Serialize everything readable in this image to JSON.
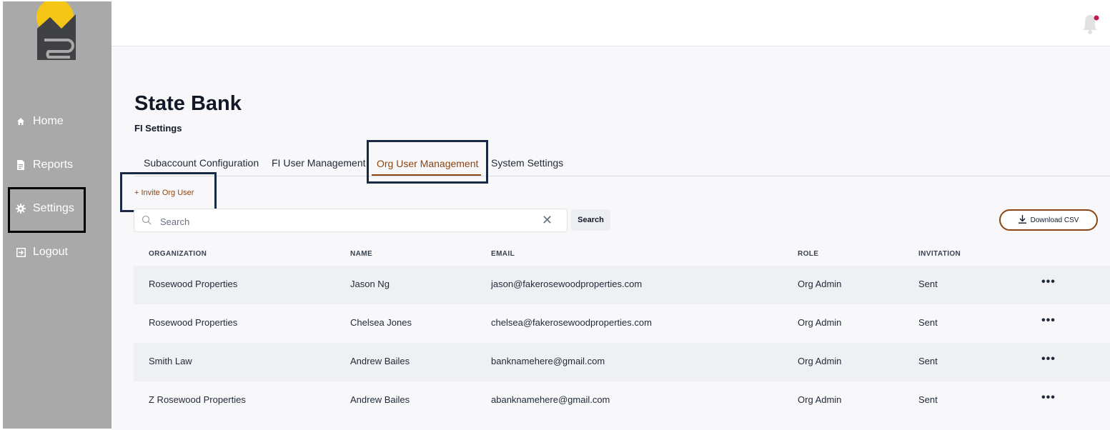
{
  "sidebar": {
    "items": [
      {
        "label": "Home",
        "icon": "home-icon"
      },
      {
        "label": "Reports",
        "icon": "document-icon"
      },
      {
        "label": "Settings",
        "icon": "gear-icon"
      },
      {
        "label": "Logout",
        "icon": "logout-icon"
      }
    ]
  },
  "header": {
    "title": "State Bank",
    "subtitle": "FI Settings"
  },
  "tabs": [
    {
      "label": "Subaccount Configuration"
    },
    {
      "label": "FI User Management"
    },
    {
      "label": "Org User Management",
      "active": true
    },
    {
      "label": "System Settings"
    }
  ],
  "actions": {
    "invite": "+ Invite Org User",
    "search_placeholder": "Search",
    "search_button": "Search",
    "download_csv": "Download CSV"
  },
  "table": {
    "headers": [
      "ORGANIZATION",
      "NAME",
      "EMAIL",
      "ROLE",
      "INVITATION"
    ],
    "rows": [
      {
        "organization": "Rosewood Properties",
        "name": "Jason Ng",
        "email": "jason@fakerosewoodproperties.com",
        "role": "Org Admin",
        "invitation": "Sent"
      },
      {
        "organization": "Rosewood Properties",
        "name": "Chelsea Jones",
        "email": "chelsea@fakerosewoodproperties.com",
        "role": "Org Admin",
        "invitation": "Sent"
      },
      {
        "organization": "Smith Law",
        "name": "Andrew Bailes",
        "email": "banknamehere@gmail.com",
        "role": "Org Admin",
        "invitation": "Sent"
      },
      {
        "organization": "Z Rosewood Properties",
        "name": "Andrew Bailes",
        "email": "abanknamehere@gmail.com",
        "role": "Org Admin",
        "invitation": "Sent"
      }
    ],
    "row_menu": "•••"
  },
  "colors": {
    "sidebar": "#a9a9a9",
    "accent": "#8b4513",
    "highlight_border": "#1b2a44",
    "notification_dot": "#c2185b"
  }
}
